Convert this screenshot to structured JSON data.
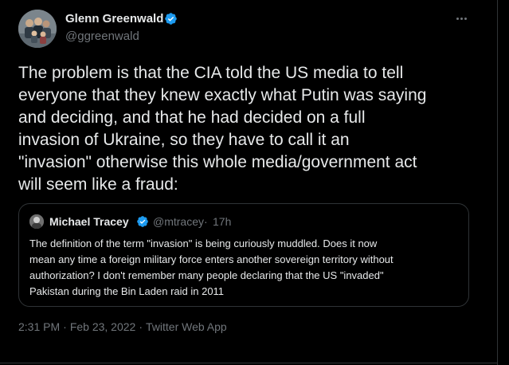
{
  "colors": {
    "background": "#000000",
    "text_primary": "#e7e9ea",
    "text_secondary": "#71767b",
    "border": "#2f3336",
    "verified": "#1d9bf0"
  },
  "tweet": {
    "author": {
      "name": "Glenn Greenwald",
      "handle": "@ggreenwald",
      "verified": true,
      "avatar_icon": "group-photo-avatar"
    },
    "more_icon": "more-options-icon",
    "text_lines": [
      "The problem is that the CIA told the US media to tell",
      "everyone that they knew exactly what Putin was saying",
      "and deciding, and that he had decided on a full",
      "invasion of Ukraine, so they have to call it an",
      "\"invasion\" otherwise this whole media/government act",
      "will seem like a fraud:"
    ],
    "quoted": {
      "name": "Michael Tracey",
      "handle": "@mtracey",
      "separator": "·",
      "time": "17h",
      "verified": true,
      "text_lines": [
        "The definition of the term \"invasion\" is being curiously muddled. Does it now",
        "mean any time a foreign military force enters another sovereign territory without",
        "authorization? I don't remember many people declaring that the US \"invaded\"",
        "Pakistan during the Bin Laden raid in 2011"
      ]
    },
    "meta": {
      "time": "2:31 PM",
      "separator": "·",
      "date": "Feb 23, 2022",
      "separator2": "·",
      "source": "Twitter Web App"
    }
  }
}
